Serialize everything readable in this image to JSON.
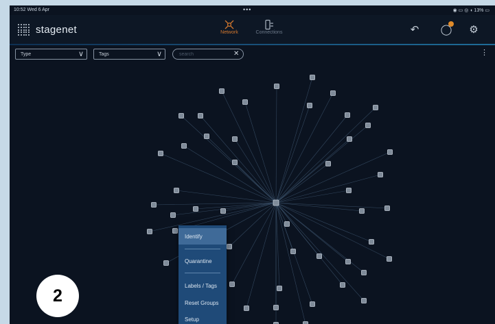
{
  "status_bar": {
    "time": "10:52  Wed 6 Apr",
    "dots": "•••",
    "system": "◉ ▭ ◎ ◖ 13% ▭"
  },
  "header": {
    "brand": "stagenet",
    "tabs": [
      {
        "label": "Network",
        "icon": "network-icon",
        "active": true
      },
      {
        "label": "Connections",
        "icon": "connections-icon",
        "active": false
      }
    ],
    "undo_icon": "↶",
    "chat_icon": "◯",
    "gear_icon": "⚙"
  },
  "toolbar": {
    "type_label": "Type",
    "tags_label": "Tags",
    "search_placeholder": "search",
    "clear_icon": "✕",
    "more_icon": "⋮",
    "chevron": "∨"
  },
  "context_menu": {
    "items": [
      "Identify",
      "Quarantine",
      "Labels / Tags",
      "Reset Groups",
      "Setup"
    ],
    "highlighted": "Identify"
  },
  "step_badge": "2",
  "colors": {
    "accent": "#d4782e",
    "background": "#0b1320",
    "menu": "#1f4a78",
    "menu_highlight": "#3f6a98",
    "badge": "#e08b2a"
  },
  "graph": {
    "hub": "central-node",
    "node_count": 46,
    "node_icon": "device-node-icon"
  }
}
